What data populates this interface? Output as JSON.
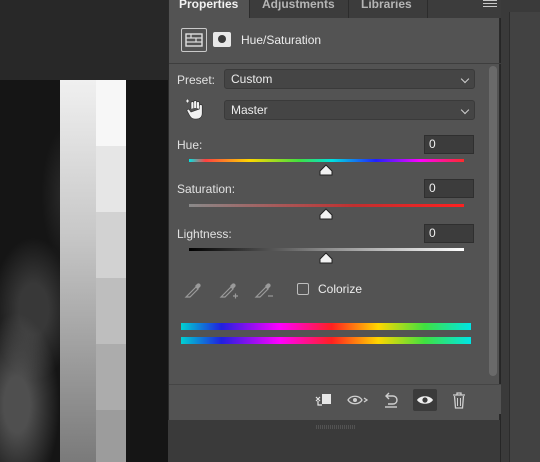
{
  "tabs": [
    {
      "label": "Properties",
      "active": true
    },
    {
      "label": "Adjustments",
      "active": false
    },
    {
      "label": "Libraries",
      "active": false
    }
  ],
  "panel": {
    "title": "Hue/Saturation",
    "preset_label": "Preset:",
    "preset_value": "Custom",
    "channel_value": "Master"
  },
  "sliders": {
    "hue": {
      "label": "Hue:",
      "value": "0"
    },
    "saturation": {
      "label": "Saturation:",
      "value": "0"
    },
    "lightness": {
      "label": "Lightness:",
      "value": "0"
    }
  },
  "colorize": {
    "label": "Colorize",
    "checked": false
  },
  "icons": {
    "panel_menu": "hamburger-menu-icon",
    "adjustment": "hue-saturation-adjustment-icon",
    "mask": "layer-mask-icon",
    "target": "on-image-adjustment-hand-icon",
    "eyedroppers": [
      "eyedropper-icon",
      "eyedropper-add-icon",
      "eyedropper-subtract-icon"
    ],
    "footer": [
      "clip-to-layer-icon",
      "view-previous-state-icon",
      "reset-icon",
      "visibility-eye-icon",
      "delete-trash-icon"
    ]
  },
  "colors": {
    "panel_bg": "#535353",
    "tab_bar_bg": "#3c3c3c",
    "field_bg": "#454545"
  }
}
